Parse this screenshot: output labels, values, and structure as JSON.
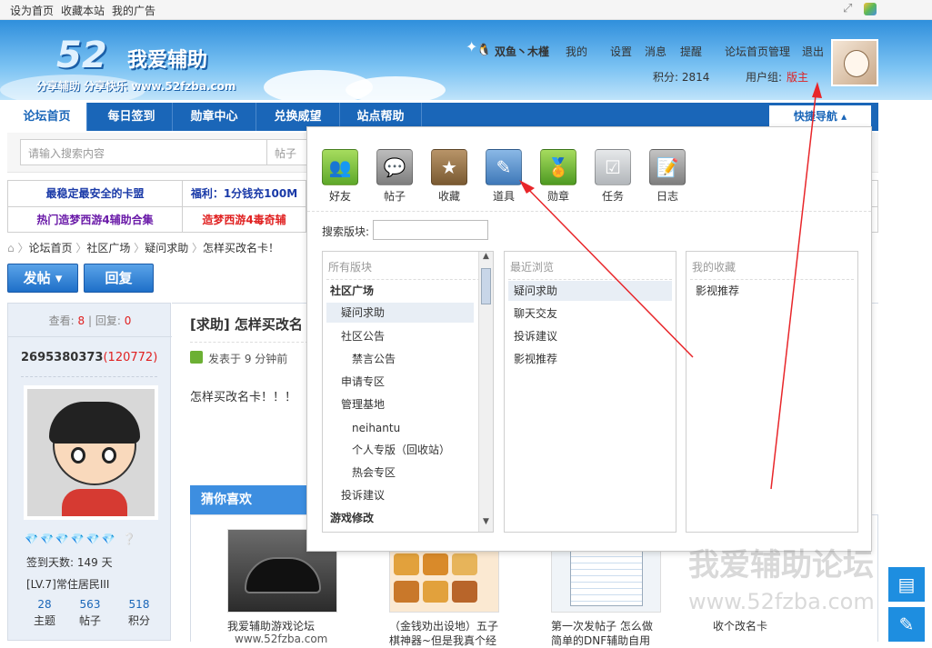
{
  "topbar": {
    "set_home": "设为首页",
    "favorite": "收藏本站",
    "my_ads": "我的广告"
  },
  "header": {
    "logo_number": "52",
    "logo_text": "我爱辅助",
    "logo_sub": "分享辅助  分享快乐  www.52fzba.com"
  },
  "user": {
    "name": "双鱼丶木槿",
    "my": "我的",
    "settings": "设置",
    "messages": "消息",
    "remind": "提醒",
    "admin": "论坛首页管理",
    "logout": "退出",
    "points_label": "积分: 2814",
    "group_label": "用户组:",
    "group_value": "版主"
  },
  "nav": {
    "items": [
      "论坛首页",
      "每日签到",
      "勋章中心",
      "兑换威望",
      "站点帮助"
    ],
    "quick_nav": "快捷导航"
  },
  "search": {
    "placeholder": "请输入搜索内容",
    "type": "帖子"
  },
  "ads": {
    "r1c1": "最稳定最安全的卡盟",
    "r1c2": "福利：1分钱充100M",
    "r2c1": "热门造梦西游4辅助合集",
    "r2c2": "造梦西游4毒奇辅"
  },
  "breadcrumb": {
    "home": "论坛首页",
    "community": "社区广场",
    "qa": "疑问求助",
    "current": "怎样买改名卡！"
  },
  "actions": {
    "post": "发帖",
    "reply": "回复"
  },
  "thread": {
    "views_label": "查看:",
    "views": "8",
    "replies_label": "回复:",
    "replies": "0",
    "title": "[求助] 怎样买改名",
    "posted": "发表于 9 分钟前",
    "body": "怎样买改名卡！！！"
  },
  "author": {
    "uid": "2695380373",
    "score": "120772",
    "signin": "签到天数: 149 天",
    "level": "[LV.7]常住居民III",
    "topics": "28",
    "topics_label": "主题",
    "posts": "563",
    "posts_label": "帖子",
    "points": "518",
    "points_label": "积分"
  },
  "quickpanel": {
    "icons": [
      {
        "label": "好友",
        "color": "#7bbf3a"
      },
      {
        "label": "帖子",
        "color": "#8a8a8a"
      },
      {
        "label": "收藏",
        "color": "#8f6a3a"
      },
      {
        "label": "道具",
        "color": "#5a8fc8"
      },
      {
        "label": "勋章",
        "color": "#6cb034"
      },
      {
        "label": "任务",
        "color": "#c4c8cc"
      },
      {
        "label": "日志",
        "color": "#8a8a8a"
      }
    ],
    "search_label": "搜索版块:",
    "col1_title": "所有版块",
    "col1_items": [
      "社区广场",
      "疑问求助",
      "社区公告",
      "禁言公告",
      "申请专区",
      "管理基地",
      "neihantu",
      "个人专版（回收站）",
      "热会专区",
      "投诉建议",
      "游戏修改"
    ],
    "col2_title": "最近浏览",
    "col2_items": [
      "疑问求助",
      "聊天交友",
      "投诉建议",
      "影视推荐"
    ],
    "col3_title": "我的收藏",
    "col3_items": [
      "影视推荐"
    ]
  },
  "guess": {
    "title": "猜你喜欢",
    "items": [
      "我爱辅助游戏论坛",
      "（金钱劝出设地）五子",
      "第一次发帖子 怎么做",
      "收个改名卡"
    ],
    "items_line2": [
      "www.52fzba.com",
      "棋神器~但是我真个经",
      "简单的DNF辅助自用",
      ""
    ]
  },
  "watermark": {
    "line1": "我爱辅助论坛",
    "line2": "www.52fzba.com"
  },
  "colors": {
    "nav": "#1a66b8",
    "arrow": "#e8262a",
    "accent_red": "#e02020"
  }
}
